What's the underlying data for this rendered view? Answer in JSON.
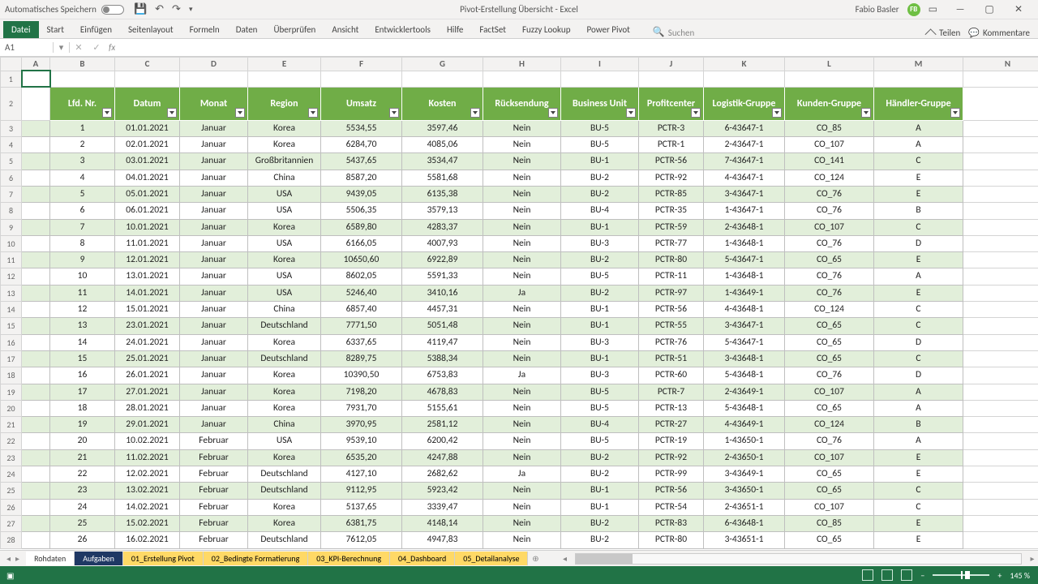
{
  "title_bar": {
    "autosave_label": "Automatisches Speichern",
    "doc_title": "Pivot-Erstellung Übersicht  -  Excel",
    "user_name": "Fabio Basler",
    "user_initials": "FB"
  },
  "ribbon": {
    "tabs": [
      "Datei",
      "Start",
      "Einfügen",
      "Seitenlayout",
      "Formeln",
      "Daten",
      "Überprüfen",
      "Ansicht",
      "Entwicklertools",
      "Hilfe",
      "FactSet",
      "Fuzzy Lookup",
      "Power Pivot"
    ],
    "search_placeholder": "Suchen",
    "share_label": "Teilen",
    "comments_label": "Kommentare"
  },
  "name_box": "A1",
  "columns_letters": [
    "A",
    "B",
    "C",
    "D",
    "E",
    "F",
    "G",
    "H",
    "I",
    "J",
    "K",
    "L",
    "M",
    "N"
  ],
  "headers": [
    "Lfd. Nr.",
    "Datum",
    "Monat",
    "Region",
    "Umsatz",
    "Kosten",
    "Rücksendung",
    "Business Unit",
    "Profitcenter",
    "Logistik-Gruppe",
    "Kunden-Gruppe",
    "Händler-Gruppe"
  ],
  "rows": [
    [
      "1",
      "01.01.2021",
      "Januar",
      "Korea",
      "5534,55",
      "3597,46",
      "Nein",
      "BU-5",
      "PCTR-3",
      "6-43647-1",
      "CO_85",
      "A"
    ],
    [
      "2",
      "02.01.2021",
      "Januar",
      "Korea",
      "6284,70",
      "4085,06",
      "Nein",
      "BU-5",
      "PCTR-1",
      "2-43647-1",
      "CO_107",
      "A"
    ],
    [
      "3",
      "03.01.2021",
      "Januar",
      "Großbritannien",
      "5437,65",
      "3534,47",
      "Nein",
      "BU-1",
      "PCTR-56",
      "7-43647-1",
      "CO_141",
      "C"
    ],
    [
      "4",
      "04.01.2021",
      "Januar",
      "China",
      "8587,20",
      "5581,68",
      "Nein",
      "BU-2",
      "PCTR-92",
      "4-43647-1",
      "CO_124",
      "E"
    ],
    [
      "5",
      "05.01.2021",
      "Januar",
      "USA",
      "9439,05",
      "6135,38",
      "Nein",
      "BU-2",
      "PCTR-85",
      "3-43647-1",
      "CO_76",
      "E"
    ],
    [
      "6",
      "06.01.2021",
      "Januar",
      "USA",
      "5506,35",
      "3579,13",
      "Nein",
      "BU-4",
      "PCTR-35",
      "1-43647-1",
      "CO_76",
      "B"
    ],
    [
      "7",
      "10.01.2021",
      "Januar",
      "Korea",
      "6589,80",
      "4283,37",
      "Nein",
      "BU-1",
      "PCTR-59",
      "2-43648-1",
      "CO_107",
      "C"
    ],
    [
      "8",
      "11.01.2021",
      "Januar",
      "USA",
      "6166,05",
      "4007,93",
      "Nein",
      "BU-3",
      "PCTR-77",
      "1-43648-1",
      "CO_76",
      "D"
    ],
    [
      "9",
      "12.01.2021",
      "Januar",
      "Korea",
      "10650,60",
      "6922,89",
      "Nein",
      "BU-2",
      "PCTR-80",
      "5-43647-1",
      "CO_65",
      "E"
    ],
    [
      "10",
      "13.01.2021",
      "Januar",
      "USA",
      "8602,05",
      "5591,33",
      "Nein",
      "BU-5",
      "PCTR-11",
      "1-43648-1",
      "CO_76",
      "A"
    ],
    [
      "11",
      "14.01.2021",
      "Januar",
      "USA",
      "5246,40",
      "3410,16",
      "Ja",
      "BU-2",
      "PCTR-97",
      "1-43649-1",
      "CO_76",
      "E"
    ],
    [
      "12",
      "15.01.2021",
      "Januar",
      "China",
      "6857,40",
      "4457,31",
      "Nein",
      "BU-1",
      "PCTR-56",
      "4-43648-1",
      "CO_124",
      "C"
    ],
    [
      "13",
      "23.01.2021",
      "Januar",
      "Deutschland",
      "7771,50",
      "5051,48",
      "Nein",
      "BU-1",
      "PCTR-55",
      "3-43647-1",
      "CO_65",
      "C"
    ],
    [
      "14",
      "24.01.2021",
      "Januar",
      "Korea",
      "6337,65",
      "4119,47",
      "Nein",
      "BU-3",
      "PCTR-76",
      "5-43647-1",
      "CO_65",
      "D"
    ],
    [
      "15",
      "25.01.2021",
      "Januar",
      "Deutschland",
      "8289,75",
      "5388,34",
      "Nein",
      "BU-1",
      "PCTR-51",
      "3-43648-1",
      "CO_65",
      "C"
    ],
    [
      "16",
      "26.01.2021",
      "Januar",
      "Korea",
      "10390,50",
      "6753,83",
      "Ja",
      "BU-3",
      "PCTR-60",
      "5-43648-1",
      "CO_76",
      "D"
    ],
    [
      "17",
      "27.01.2021",
      "Januar",
      "Korea",
      "7198,20",
      "4678,83",
      "Nein",
      "BU-5",
      "PCTR-7",
      "2-43649-1",
      "CO_107",
      "A"
    ],
    [
      "18",
      "28.01.2021",
      "Januar",
      "Korea",
      "7931,70",
      "5155,61",
      "Nein",
      "BU-5",
      "PCTR-13",
      "5-43648-1",
      "CO_65",
      "A"
    ],
    [
      "19",
      "29.01.2021",
      "Januar",
      "China",
      "3970,95",
      "2581,12",
      "Nein",
      "BU-4",
      "PCTR-27",
      "4-43649-1",
      "CO_124",
      "B"
    ],
    [
      "20",
      "10.02.2021",
      "Februar",
      "USA",
      "9539,10",
      "6200,42",
      "Nein",
      "BU-5",
      "PCTR-19",
      "1-43650-1",
      "CO_76",
      "A"
    ],
    [
      "21",
      "11.02.2021",
      "Februar",
      "Korea",
      "6535,20",
      "4247,88",
      "Nein",
      "BU-2",
      "PCTR-92",
      "2-43650-1",
      "CO_107",
      "E"
    ],
    [
      "22",
      "12.02.2021",
      "Februar",
      "Deutschland",
      "4127,10",
      "2682,62",
      "Ja",
      "BU-2",
      "PCTR-99",
      "3-43649-1",
      "CO_65",
      "E"
    ],
    [
      "23",
      "13.02.2021",
      "Februar",
      "Deutschland",
      "9112,95",
      "5923,42",
      "Nein",
      "BU-1",
      "PCTR-56",
      "3-43650-1",
      "CO_65",
      "C"
    ],
    [
      "24",
      "14.02.2021",
      "Februar",
      "Korea",
      "5137,65",
      "3339,47",
      "Nein",
      "BU-1",
      "PCTR-54",
      "2-43651-1",
      "CO_107",
      "C"
    ],
    [
      "25",
      "15.02.2021",
      "Februar",
      "Korea",
      "6381,75",
      "4148,14",
      "Nein",
      "BU-2",
      "PCTR-83",
      "6-43648-1",
      "CO_85",
      "E"
    ],
    [
      "26",
      "16.02.2021",
      "Februar",
      "Deutschland",
      "7612,05",
      "4947,83",
      "Nein",
      "BU-2",
      "PCTR-80",
      "3-43651-1",
      "CO_65",
      "E"
    ]
  ],
  "sheet_tabs": [
    {
      "label": "Rohdaten",
      "style": "plain"
    },
    {
      "label": "Aufgaben",
      "style": "active"
    },
    {
      "label": "01_Erstellung Pivot",
      "style": "yellow"
    },
    {
      "label": "02_Bedingte Formatierung",
      "style": "yellow"
    },
    {
      "label": "03_KPI-Berechnung",
      "style": "yellow"
    },
    {
      "label": "04_Dashboard",
      "style": "yellow"
    },
    {
      "label": "05_Detailanalyse",
      "style": "yellow"
    }
  ],
  "status_bar": {
    "zoom": "145 %"
  }
}
